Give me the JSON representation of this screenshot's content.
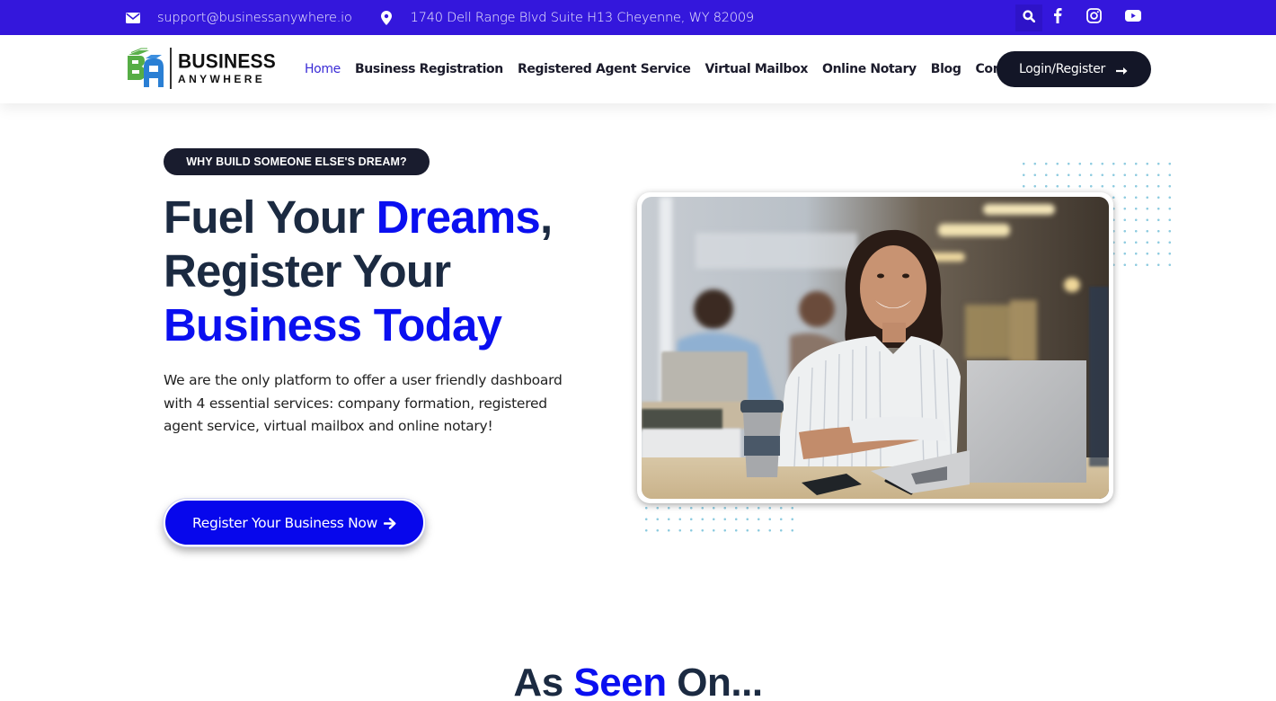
{
  "topbar": {
    "email": "support@businessanywhere.io",
    "address": "1740 Dell Range Blvd Suite H13 Cheyenne, WY 82009",
    "icons": [
      "envelope-icon",
      "map-pin-icon",
      "search-icon",
      "facebook-icon",
      "instagram-icon",
      "youtube-icon"
    ]
  },
  "header": {
    "logo": {
      "line1": "BUSINESS",
      "line2": "ANYWHERE"
    },
    "nav": [
      {
        "label": "Home",
        "active": true
      },
      {
        "label": "Business Registration",
        "active": false
      },
      {
        "label": "Registered Agent Service",
        "active": false
      },
      {
        "label": "Virtual Mailbox",
        "active": false
      },
      {
        "label": "Online Notary",
        "active": false
      },
      {
        "label": "Blog",
        "active": false
      },
      {
        "label": "Contact",
        "active": false
      }
    ],
    "login_label": "Login/Register"
  },
  "hero": {
    "badge": "WHY BUILD SOMEONE ELSE'S DREAM?",
    "headline": {
      "part1": "Fuel Your ",
      "accent1": "Dreams",
      "part2": ",",
      "line2": "Register Your",
      "accent2": "Business Today"
    },
    "description": "We are the only platform to offer a user friendly dashboard with 4 essential services: company formation, registered agent service, virtual mailbox and online notary!",
    "cta_label": "Register Your Business Now",
    "image_alt": "Smiling woman working on a laptop in a coworking space"
  },
  "seen_on": {
    "part1": "As ",
    "accent": "Seen",
    "part2": " On..."
  },
  "colors": {
    "topbar": "#3417dc",
    "accent_blue": "#0a0ff0",
    "dark_navy": "#1b2a41",
    "button_dark": "#131627",
    "nav_active": "#3a2bd6"
  }
}
